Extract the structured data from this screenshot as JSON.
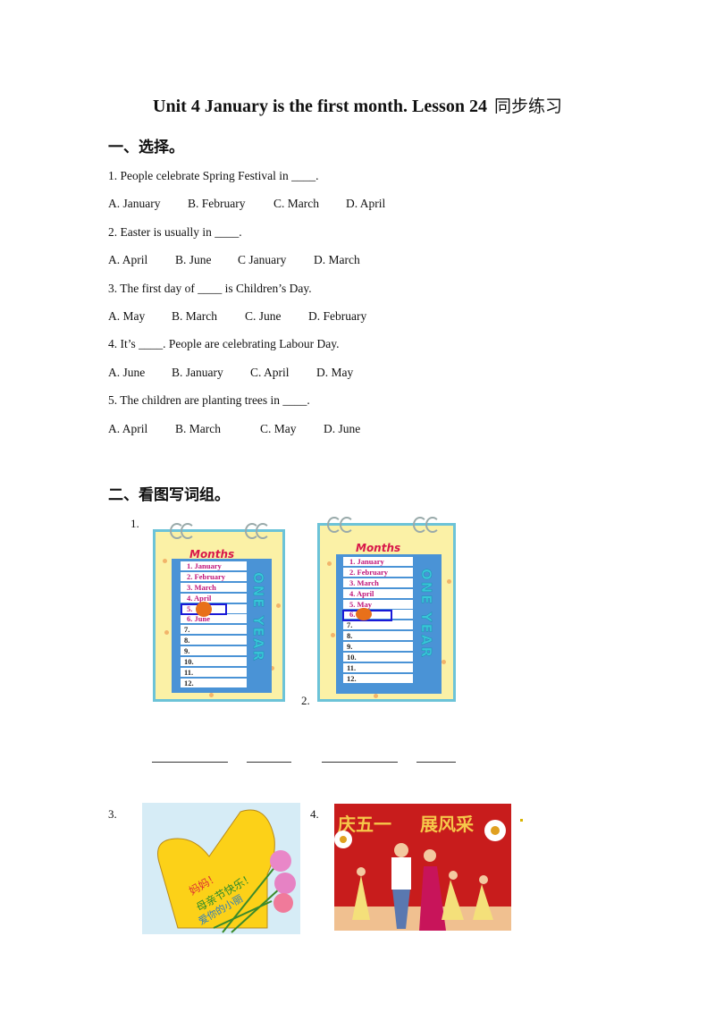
{
  "title": {
    "english": "Unit 4 January is the first month. Lesson 24",
    "chinese": "同步练习"
  },
  "section1": {
    "heading": "一、选择。",
    "questions": [
      {
        "stem": "1. People celebrate Spring Festival in ____.",
        "options": [
          "A. January",
          "B. February",
          "C. March",
          "D. April"
        ]
      },
      {
        "stem": "2. Easter is usually in ____.",
        "options": [
          "A. April",
          "B. June",
          "C January",
          "D. March"
        ]
      },
      {
        "stem": "3. The first day of ____ is Children’s Day.",
        "options": [
          "A. May",
          "B. March",
          "C. June",
          "D. February"
        ]
      },
      {
        "stem": "4. It’s ____. People are celebrating Labour Day.",
        "options": [
          "A. June",
          "B. January",
          "C. April",
          "D. May"
        ]
      },
      {
        "stem": "5. The children are planting trees in ____.",
        "options": [
          "A. April",
          "B. March",
          "C. May",
          "D. June"
        ]
      }
    ]
  },
  "section2": {
    "heading": "二、看图写词组。",
    "items": [
      {
        "number": "1.",
        "calendar": {
          "header": "Months",
          "side_text": "ONE YEAR",
          "rows": [
            "1. January",
            "2. February",
            "3. March",
            "4. April",
            "5.",
            "6. June",
            "7.",
            "8.",
            "9.",
            "10.",
            "11.",
            "12."
          ],
          "highlighted_row": 5
        }
      },
      {
        "number": "2.",
        "calendar": {
          "header": "Months",
          "side_text": "ONE YEAR",
          "rows": [
            "1. January",
            "2. February",
            "3. March",
            "4. April",
            "5. May",
            "6.",
            "7.",
            "8.",
            "9.",
            "10.",
            "11.",
            "12."
          ],
          "highlighted_row": 6
        }
      },
      {
        "number": "3.",
        "image": "mothers-day-heart-card",
        "card_text": [
          "妈妈！",
          "母亲节快乐！",
          "爱你的小丽"
        ]
      },
      {
        "number": "4.",
        "image": "labour-day-performance",
        "banner_text": [
          "庆五一",
          "展风采"
        ]
      }
    ]
  }
}
